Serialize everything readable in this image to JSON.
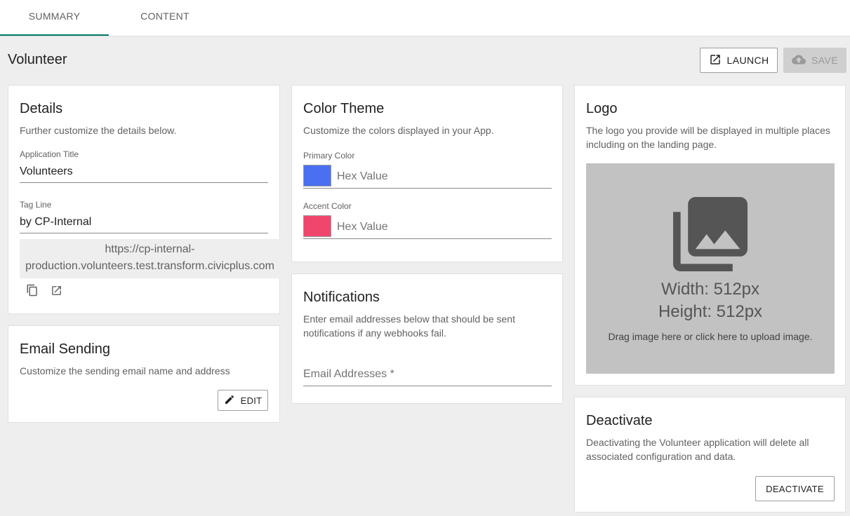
{
  "tabs": [
    {
      "label": "SUMMARY",
      "active": true
    },
    {
      "label": "CONTENT",
      "active": false
    }
  ],
  "page": {
    "title": "Volunteer"
  },
  "toolbar": {
    "launch_label": "LAUNCH",
    "save_label": "SAVE"
  },
  "details": {
    "title": "Details",
    "description": "Further customize the details below.",
    "app_title_label": "Application Title",
    "app_title_value": "Volunteers",
    "tagline_label": "Tag Line",
    "tagline_value": "by CP-Internal",
    "url_line1": "https://cp-internal-",
    "url_line2": "production.volunteers.test.transform.civicplus.com",
    "icons": [
      "copy-icon",
      "open-in-new-icon"
    ]
  },
  "email_sending": {
    "title": "Email Sending",
    "description": "Customize the sending email name and address",
    "edit_label": "EDIT"
  },
  "color_theme": {
    "title": "Color Theme",
    "description": "Customize the colors displayed in your App.",
    "primary_label": "Primary Color",
    "primary_color": "#4a6ff0",
    "primary_placeholder": "Hex Value",
    "accent_label": "Accent Color",
    "accent_color": "#f0466e",
    "accent_placeholder": "Hex Value"
  },
  "notifications": {
    "title": "Notifications",
    "description_line1": "Enter email addresses below that should be sent",
    "description_line2": "notifications if any webhooks fail.",
    "email_placeholder": "Email Addresses *"
  },
  "logo": {
    "title": "Logo",
    "description_line1": "The logo you provide will be displayed in multiple places",
    "description_line2": "including on the landing page.",
    "width_text": "Width: 512px",
    "height_text": "Height: 512px",
    "upload_hint": "Drag image here or click here to upload image."
  },
  "deactivate": {
    "title": "Deactivate",
    "description_line1": "Deactivating the Volunteer application will delete all",
    "description_line2": "associated configuration and data.",
    "button_label": "DEACTIVATE"
  },
  "colors": {
    "accent": "#00796b",
    "card": "#ffffff",
    "background": "#eeeeee"
  }
}
